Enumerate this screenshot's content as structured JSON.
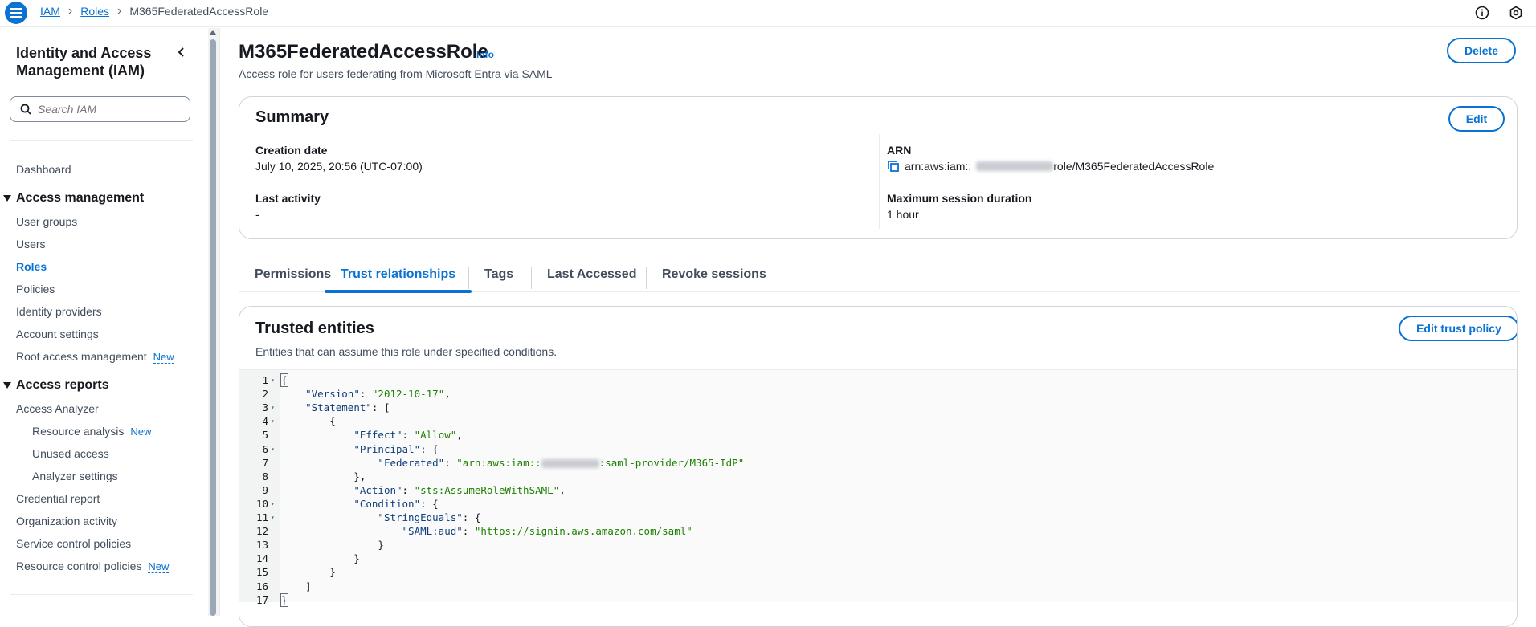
{
  "breadcrumbs": [
    "IAM",
    "Roles",
    "M365FederatedAccessRole"
  ],
  "sidebar": {
    "title": "Identity and Access Management (IAM)",
    "search_placeholder": "Search IAM",
    "dashboard": "Dashboard",
    "sections": {
      "access_management": "Access management",
      "access_reports": "Access reports"
    },
    "access_management_items": [
      "User groups",
      "Users",
      "Roles",
      "Policies",
      "Identity providers",
      "Account settings",
      "Root access management"
    ],
    "access_reports_items": [
      "Access Analyzer",
      "Resource analysis",
      "Unused access",
      "Analyzer settings",
      "Credential report",
      "Organization activity",
      "Service control policies",
      "Resource control policies"
    ],
    "new_badge": "New"
  },
  "page": {
    "title": "M365FederatedAccessRole",
    "info": "Info",
    "description": "Access role for users federating from Microsoft Entra via SAML",
    "delete_label": "Delete"
  },
  "summary": {
    "title": "Summary",
    "edit_label": "Edit",
    "creation_date_label": "Creation date",
    "creation_date_value": "July 10, 2025, 20:56 (UTC-07:00)",
    "last_activity_label": "Last activity",
    "last_activity_value": "-",
    "arn_label": "ARN",
    "arn_prefix": "arn:aws:iam::",
    "arn_suffix": "role/M365FederatedAccessRole",
    "max_session_label": "Maximum session duration",
    "max_session_value": "1 hour"
  },
  "tabs": [
    "Permissions",
    "Trust relationships",
    "Tags",
    "Last Accessed",
    "Revoke sessions"
  ],
  "active_tab": "Trust relationships",
  "trusted_entities": {
    "title": "Trusted entities",
    "edit_label": "Edit trust policy",
    "description": "Entities that can assume this role under specified conditions."
  },
  "code_lines": [
    {
      "n": "1",
      "fold": true,
      "text": "{"
    },
    {
      "n": "2",
      "fold": false,
      "text": "    \"Version\": \"2012-10-17\","
    },
    {
      "n": "3",
      "fold": true,
      "text": "    \"Statement\": ["
    },
    {
      "n": "4",
      "fold": true,
      "text": "        {"
    },
    {
      "n": "5",
      "fold": false,
      "text": "            \"Effect\": \"Allow\","
    },
    {
      "n": "6",
      "fold": true,
      "text": "            \"Principal\": {"
    },
    {
      "n": "7",
      "fold": false,
      "text": "                \"Federated\": \"arn:aws:iam::            :saml-provider/M365-IdP\""
    },
    {
      "n": "8",
      "fold": false,
      "text": "            },"
    },
    {
      "n": "9",
      "fold": false,
      "text": "            \"Action\": \"sts:AssumeRoleWithSAML\","
    },
    {
      "n": "10",
      "fold": true,
      "text": "            \"Condition\": {"
    },
    {
      "n": "11",
      "fold": true,
      "text": "                \"StringEquals\": {"
    },
    {
      "n": "12",
      "fold": false,
      "text": "                    \"SAML:aud\": \"https://signin.aws.amazon.com/saml\""
    },
    {
      "n": "13",
      "fold": false,
      "text": "                }"
    },
    {
      "n": "14",
      "fold": false,
      "text": "            }"
    },
    {
      "n": "15",
      "fold": false,
      "text": "        }"
    },
    {
      "n": "16",
      "fold": false,
      "text": "    ]"
    },
    {
      "n": "17",
      "fold": false,
      "text": "}"
    }
  ],
  "colors": {
    "accent": "#0972d3",
    "string": "#1d8102",
    "key": "#0e3e7a"
  }
}
